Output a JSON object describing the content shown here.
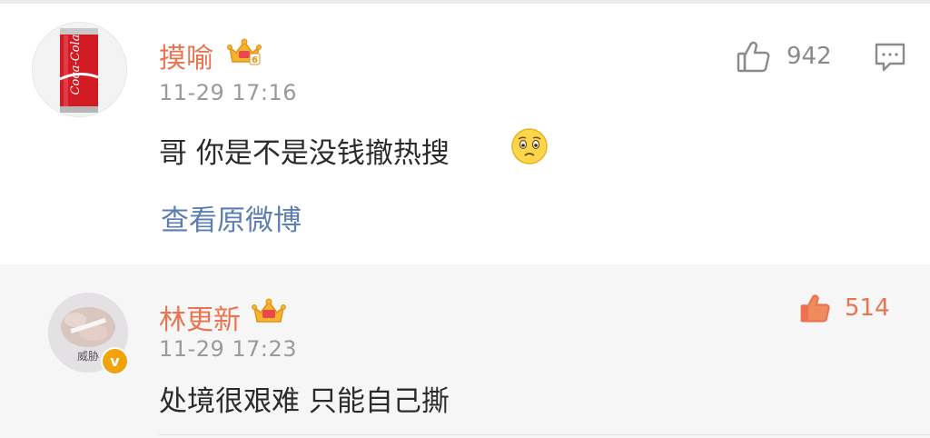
{
  "comments": [
    {
      "username": "摸喻",
      "vip_level": "6",
      "time": "11-29 17:16",
      "content": "哥 你是不是没钱撤热搜",
      "like_count": "942",
      "liked": false,
      "view_link": "查看原微博",
      "avatar_text": "Coca-Cola"
    },
    {
      "username": "林更新",
      "time": "11-29 17:23",
      "content": "处境很艰难 只能自己撕",
      "like_count": "514",
      "liked": true,
      "avatar_text": "威胁",
      "verified_mark": "v"
    }
  ],
  "colors": {
    "username": "#eb7350",
    "link": "#5d7eb0",
    "timestamp": "#9a9a9a",
    "liked": "#eb7350",
    "reply_bg": "#f6f6f6"
  },
  "icons": [
    "vip-crown-icon",
    "thumbs-up-icon",
    "reply-comment-icon",
    "sad-face-emoji",
    "verified-badge-icon"
  ]
}
